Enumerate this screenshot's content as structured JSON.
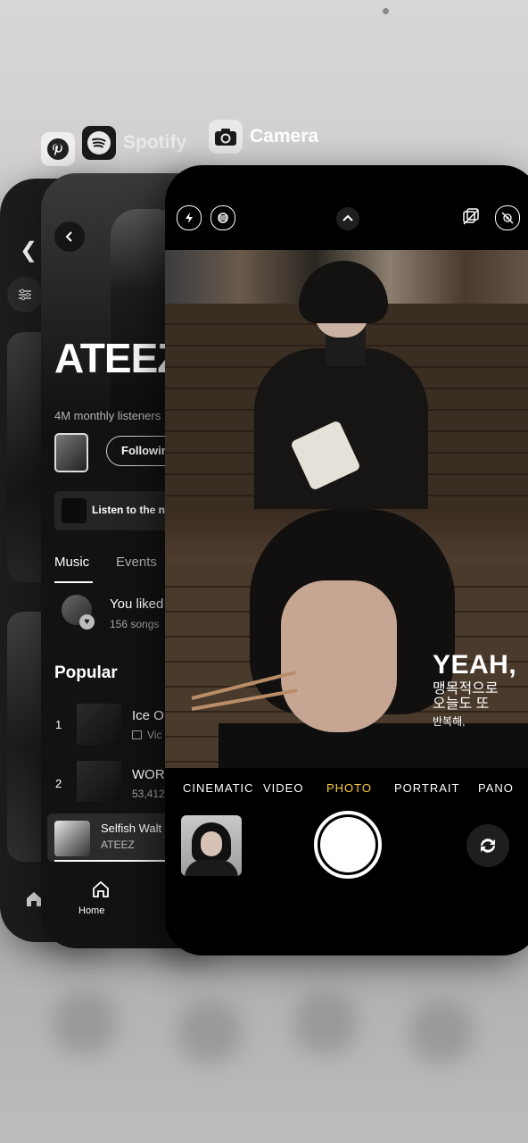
{
  "switcher": {
    "apps": [
      {
        "name": "Pinterest",
        "icon": "pinterest-icon"
      },
      {
        "name": "Spotify",
        "icon": "spotify-icon"
      },
      {
        "name": "Camera",
        "icon": "camera-icon"
      }
    ]
  },
  "spotify": {
    "artist": "ATEEZ",
    "monthly_listeners": "4M monthly listeners",
    "follow_label": "Following",
    "listen_label": "Listen to the n",
    "tabs": [
      "Music",
      "Events"
    ],
    "liked": {
      "title": "You liked",
      "subtitle": "156 songs"
    },
    "popular_heading": "Popular",
    "tracks": [
      {
        "num": "1",
        "title": "Ice O",
        "sub": "Vic"
      },
      {
        "num": "2",
        "title": "WOR",
        "sub": "53,412"
      }
    ],
    "now_playing": {
      "title": "Selfish Walt",
      "artist": "ATEEZ"
    },
    "nav": {
      "home_label": "Home"
    }
  },
  "camera": {
    "overlay": {
      "headline": "YEAH,",
      "line1": "맹목적으로",
      "line2": "오늘도 또",
      "line3": "반복해,"
    },
    "modes": [
      "CINEMATIC",
      "VIDEO",
      "PHOTO",
      "PORTRAIT",
      "PANO"
    ],
    "selected_mode": "PHOTO"
  },
  "colors": {
    "spotify_bg": "#121212",
    "camera_bg": "#000000",
    "camera_mode_selected": "#ffcf3d"
  }
}
